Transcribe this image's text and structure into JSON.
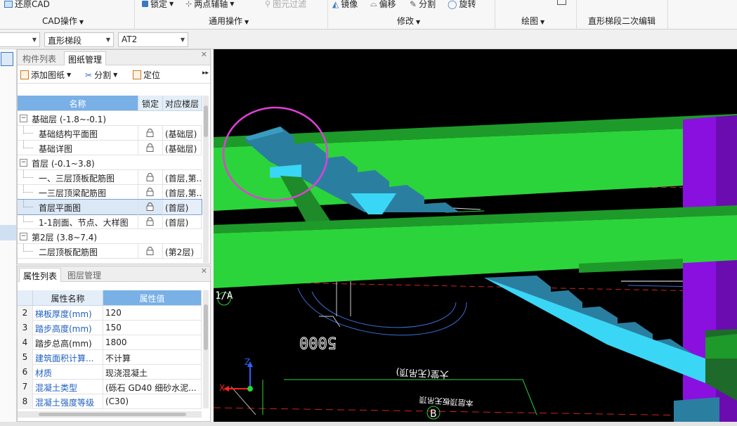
{
  "ribbon": {
    "cad_group": {
      "restore_cad": "还原CAD",
      "label": "CAD操作"
    },
    "common_group": {
      "lock": "锁定",
      "two_point_axis": "两点辅轴",
      "filter": "图元过滤",
      "label": "通用操作"
    },
    "modify_group": {
      "mirror": "镜像",
      "offset": "偏移",
      "split": "分割",
      "rotate": "旋转",
      "label": "修改"
    },
    "draw_group": {
      "label": "绘图"
    },
    "stair_group": {
      "label": "直形梯段二次编辑"
    }
  },
  "toolbar": {
    "combo1": "",
    "combo2": "直形梯段",
    "combo3": "AT2"
  },
  "drawing_panel": {
    "tabs": [
      "构件列表",
      "图纸管理"
    ],
    "active_tab": 1,
    "tools": {
      "add": "添加图纸",
      "split": "分割",
      "locate": "定位"
    },
    "headers": {
      "name": "名称",
      "lock": "锁定",
      "floor": "对应楼层"
    },
    "rows": [
      {
        "type": "group",
        "toggle": "−",
        "name": "基础层 (-1.8~-0.1)"
      },
      {
        "type": "item",
        "name": "基础结构平面图",
        "floor": "(基础层)"
      },
      {
        "type": "item",
        "name": "基础详图",
        "floor": "(基础层)"
      },
      {
        "type": "group",
        "toggle": "−",
        "name": "首层 (-0.1~3.8)"
      },
      {
        "type": "item",
        "name": "一、三层顶板配筋图",
        "floor": "(首层,第..."
      },
      {
        "type": "item",
        "name": "一三层顶梁配筋图",
        "floor": "(首层,第..."
      },
      {
        "type": "item",
        "name": "首层平面图",
        "floor": "(首层)",
        "selected": true
      },
      {
        "type": "item",
        "name": "1-1剖面、节点、大样图",
        "floor": "(首层)"
      },
      {
        "type": "group",
        "toggle": "−",
        "name": "第2层 (3.8~7.4)"
      },
      {
        "type": "item",
        "name": "二层顶板配筋图",
        "floor": "(第2层)"
      }
    ]
  },
  "property_panel": {
    "tabs": [
      "属性列表",
      "图层管理"
    ],
    "active_tab": 0,
    "headers": {
      "name": "属性名称",
      "value": "属性值"
    },
    "rows": [
      {
        "idx": "2",
        "name": "梯板厚度(mm)",
        "value": "120",
        "blue": true
      },
      {
        "idx": "3",
        "name": "踏步高度(mm)",
        "value": "150",
        "blue": true
      },
      {
        "idx": "4",
        "name": "踏步总高(mm)",
        "value": "1800",
        "blue": false
      },
      {
        "idx": "5",
        "name": "建筑面积计算...",
        "value": "不计算",
        "blue": true
      },
      {
        "idx": "6",
        "name": "材质",
        "value": "现浇混凝土",
        "blue": true
      },
      {
        "idx": "7",
        "name": "混凝土类型",
        "value": "(砾石 GD40 细砂水泥...",
        "blue": true
      },
      {
        "idx": "8",
        "name": "混凝土强度等级",
        "value": "(C30)",
        "blue": true
      }
    ]
  },
  "viewport": {
    "axis_label_a": "1/A",
    "axis_label_b": "B",
    "dim_text": "5000",
    "note_text_1": "大堂(无吊顶)",
    "note_text_2": "本层顶板无吊顶",
    "axis_z": "Z",
    "axis_x": "X",
    "colors": {
      "beam": "#2bd43a",
      "stair": "#2a7fa0",
      "stair_light": "#3ad6f5",
      "column": "#8a10e0",
      "highlight": "#e23fd8"
    }
  }
}
